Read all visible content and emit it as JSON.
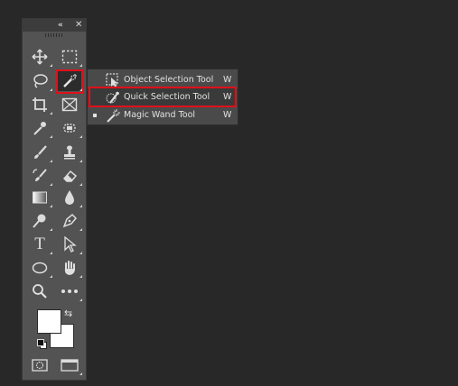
{
  "panel": {
    "collapse_glyph": "«",
    "close_glyph": "✕"
  },
  "tools": [
    {
      "name": "move-tool",
      "icon": "move-icon"
    },
    {
      "name": "rectangular-marquee-tool",
      "icon": "marquee-icon"
    },
    {
      "name": "lasso-tool",
      "icon": "lasso-icon"
    },
    {
      "name": "quick-selection-tool",
      "icon": "quick-selection-icon",
      "active": true
    },
    {
      "name": "crop-tool",
      "icon": "crop-icon"
    },
    {
      "name": "frame-tool",
      "icon": "frame-icon"
    },
    {
      "name": "eyedropper-tool",
      "icon": "eyedropper-icon"
    },
    {
      "name": "spot-healing-tool",
      "icon": "healing-icon"
    },
    {
      "name": "brush-tool",
      "icon": "brush-icon"
    },
    {
      "name": "clone-stamp-tool",
      "icon": "stamp-icon"
    },
    {
      "name": "history-brush-tool",
      "icon": "history-brush-icon"
    },
    {
      "name": "eraser-tool",
      "icon": "eraser-icon"
    },
    {
      "name": "gradient-tool",
      "icon": "gradient-icon"
    },
    {
      "name": "blur-tool",
      "icon": "blur-icon"
    },
    {
      "name": "dodge-tool",
      "icon": "dodge-icon"
    },
    {
      "name": "pen-tool",
      "icon": "pen-icon"
    },
    {
      "name": "type-tool",
      "icon": "type-icon",
      "glyph": "T"
    },
    {
      "name": "path-selection-tool",
      "icon": "arrow-icon"
    },
    {
      "name": "ellipse-tool",
      "icon": "ellipse-icon"
    },
    {
      "name": "hand-tool",
      "icon": "hand-icon"
    },
    {
      "name": "zoom-tool",
      "icon": "zoom-icon"
    },
    {
      "name": "edit-toolbar",
      "icon": "more-icon"
    }
  ],
  "colors": {
    "foreground": "#ffffff",
    "background": "#ffffff",
    "swap_glyph": "⇆"
  },
  "flyout": {
    "items": [
      {
        "label": "Object Selection Tool",
        "shortcut": "W",
        "icon": "object-selection-icon"
      },
      {
        "label": "Quick Selection Tool",
        "shortcut": "W",
        "icon": "quick-selection-icon",
        "selected": true
      },
      {
        "label": "Magic Wand Tool",
        "shortcut": "W",
        "icon": "magic-wand-icon",
        "current": true
      }
    ]
  },
  "accent": {
    "highlight": "#e0101a",
    "panel": "#535353",
    "canvas": "#282828"
  }
}
